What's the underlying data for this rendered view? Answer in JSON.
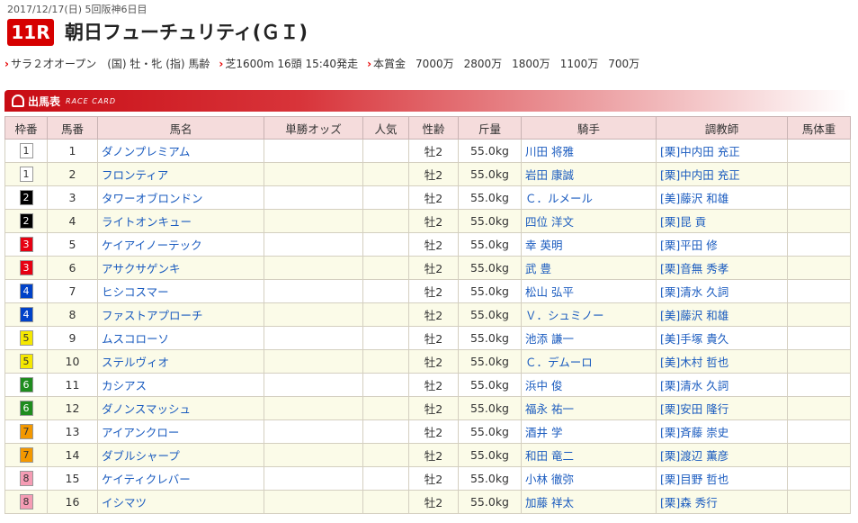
{
  "header": {
    "date_line": "2017/12/17(日) 5回阪神6日目",
    "race_number": "11R",
    "race_name": "朝日フューチュリティ(ＧＩ)",
    "condition": "サラ２才オープン　(国) 牡・牝 (指) 馬齢",
    "course": "芝1600m 16頭 15:40発走",
    "prize_label": "本賞金",
    "prizes": [
      "7000万",
      "2800万",
      "1800万",
      "1100万",
      "700万"
    ],
    "accent_color": "#d60000"
  },
  "banner": {
    "title": "出馬表",
    "subtitle": "RACE CARD",
    "icon": "horseshoe-icon"
  },
  "table": {
    "columns": [
      "枠番",
      "馬番",
      "馬名",
      "単勝オッズ",
      "人気",
      "性齢",
      "斤量",
      "騎手",
      "調教師",
      "馬体重"
    ],
    "rows": [
      {
        "waku": "1",
        "umaban": "1",
        "horse": "ダノンプレミアム",
        "odds": "",
        "pop": "",
        "sexage": "牡2",
        "weight": "55.0kg",
        "jockey": "川田 将雅",
        "trainer": "[栗]中内田 充正",
        "body": ""
      },
      {
        "waku": "1",
        "umaban": "2",
        "horse": "フロンティア",
        "odds": "",
        "pop": "",
        "sexage": "牡2",
        "weight": "55.0kg",
        "jockey": "岩田 康誠",
        "trainer": "[栗]中内田 充正",
        "body": ""
      },
      {
        "waku": "2",
        "umaban": "3",
        "horse": "タワーオブロンドン",
        "odds": "",
        "pop": "",
        "sexage": "牡2",
        "weight": "55.0kg",
        "jockey": "Ｃ．ルメール",
        "trainer": "[美]藤沢 和雄",
        "body": ""
      },
      {
        "waku": "2",
        "umaban": "4",
        "horse": "ライトオンキュー",
        "odds": "",
        "pop": "",
        "sexage": "牡2",
        "weight": "55.0kg",
        "jockey": "四位 洋文",
        "trainer": "[栗]昆 貢",
        "body": ""
      },
      {
        "waku": "3",
        "umaban": "5",
        "horse": "ケイアイノーテック",
        "odds": "",
        "pop": "",
        "sexage": "牡2",
        "weight": "55.0kg",
        "jockey": "幸 英明",
        "trainer": "[栗]平田 修",
        "body": ""
      },
      {
        "waku": "3",
        "umaban": "6",
        "horse": "アサクサゲンキ",
        "odds": "",
        "pop": "",
        "sexage": "牡2",
        "weight": "55.0kg",
        "jockey": "武 豊",
        "trainer": "[栗]音無 秀孝",
        "body": ""
      },
      {
        "waku": "4",
        "umaban": "7",
        "horse": "ヒシコスマー",
        "odds": "",
        "pop": "",
        "sexage": "牡2",
        "weight": "55.0kg",
        "jockey": "松山 弘平",
        "trainer": "[栗]清水 久詞",
        "body": ""
      },
      {
        "waku": "4",
        "umaban": "8",
        "horse": "ファストアプローチ",
        "odds": "",
        "pop": "",
        "sexage": "牡2",
        "weight": "55.0kg",
        "jockey": "Ｖ．シュミノー",
        "trainer": "[美]藤沢 和雄",
        "body": ""
      },
      {
        "waku": "5",
        "umaban": "9",
        "horse": "ムスコローソ",
        "odds": "",
        "pop": "",
        "sexage": "牡2",
        "weight": "55.0kg",
        "jockey": "池添 謙一",
        "trainer": "[美]手塚 貴久",
        "body": ""
      },
      {
        "waku": "5",
        "umaban": "10",
        "horse": "ステルヴィオ",
        "odds": "",
        "pop": "",
        "sexage": "牡2",
        "weight": "55.0kg",
        "jockey": "Ｃ．デムーロ",
        "trainer": "[美]木村 哲也",
        "body": ""
      },
      {
        "waku": "6",
        "umaban": "11",
        "horse": "カシアス",
        "odds": "",
        "pop": "",
        "sexage": "牡2",
        "weight": "55.0kg",
        "jockey": "浜中 俊",
        "trainer": "[栗]清水 久詞",
        "body": ""
      },
      {
        "waku": "6",
        "umaban": "12",
        "horse": "ダノンスマッシュ",
        "odds": "",
        "pop": "",
        "sexage": "牡2",
        "weight": "55.0kg",
        "jockey": "福永 祐一",
        "trainer": "[栗]安田 隆行",
        "body": ""
      },
      {
        "waku": "7",
        "umaban": "13",
        "horse": "アイアンクロー",
        "odds": "",
        "pop": "",
        "sexage": "牡2",
        "weight": "55.0kg",
        "jockey": "酒井 学",
        "trainer": "[栗]斉藤 崇史",
        "body": ""
      },
      {
        "waku": "7",
        "umaban": "14",
        "horse": "ダブルシャープ",
        "odds": "",
        "pop": "",
        "sexage": "牡2",
        "weight": "55.0kg",
        "jockey": "和田 竜二",
        "trainer": "[栗]渡辺 薫彦",
        "body": ""
      },
      {
        "waku": "8",
        "umaban": "15",
        "horse": "ケイティクレバー",
        "odds": "",
        "pop": "",
        "sexage": "牡2",
        "weight": "55.0kg",
        "jockey": "小林 徹弥",
        "trainer": "[栗]目野 哲也",
        "body": ""
      },
      {
        "waku": "8",
        "umaban": "16",
        "horse": "イシマツ",
        "odds": "",
        "pop": "",
        "sexage": "牡2",
        "weight": "55.0kg",
        "jockey": "加藤 祥太",
        "trainer": "[栗]森 秀行",
        "body": ""
      }
    ]
  },
  "waku_colors": {
    "1": {
      "bg": "#ffffff",
      "fg": "#333333"
    },
    "2": {
      "bg": "#000000",
      "fg": "#ffffff"
    },
    "3": {
      "bg": "#e60012",
      "fg": "#ffffff"
    },
    "4": {
      "bg": "#0042c8",
      "fg": "#ffffff"
    },
    "5": {
      "bg": "#f5e800",
      "fg": "#333333"
    },
    "6": {
      "bg": "#1e8c1e",
      "fg": "#ffffff"
    },
    "7": {
      "bg": "#f39800",
      "fg": "#333333"
    },
    "8": {
      "bg": "#f59cb4",
      "fg": "#333333"
    }
  }
}
